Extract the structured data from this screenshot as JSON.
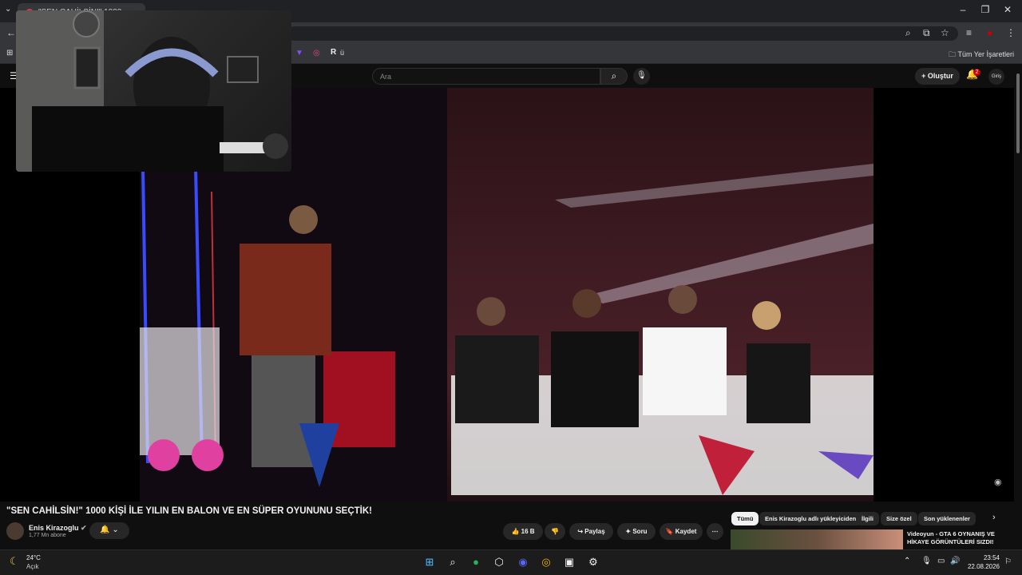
{
  "browser": {
    "tab_title": "\"SEN CAHİLSİN!\" 1000 ...",
    "bookmarks_all_label": "Tüm Yer İşaretleri"
  },
  "youtube": {
    "search_placeholder": "Ara",
    "create_label": "Oluştur",
    "notification_count": "2",
    "avatar_label": "Giriş"
  },
  "video": {
    "title": "\"SEN CAHİLSİN!\" 1000 KİŞİ İLE YILIN EN BALON VE EN SÜPER OYUNUNU SEÇTİK!",
    "channel_name": "Enis Kirazoglu",
    "subscribers": "1,77 Mn abone",
    "like_count": "16 B",
    "share_label": "Paylaş",
    "ask_label": "Soru",
    "save_label": "Kaydet"
  },
  "filters": {
    "chips": [
      "Tümü",
      "Enis Kirazoglu adlı yükleyiciden",
      "İlgili",
      "Size özel",
      "Son yüklenenler"
    ]
  },
  "recommendation": {
    "title": "Videoyun - GTA 6 OYNANIŞ VE HİKAYE GÖRÜNTÜLERİ SIZDI!"
  },
  "taskbar": {
    "temperature": "24°C",
    "condition": "Açık",
    "time": "23:54",
    "date": "22.08.2026"
  },
  "colors": {
    "accent_red": "#cc0000",
    "bg": "#0f0f0f",
    "chip_bg": "#272727"
  }
}
